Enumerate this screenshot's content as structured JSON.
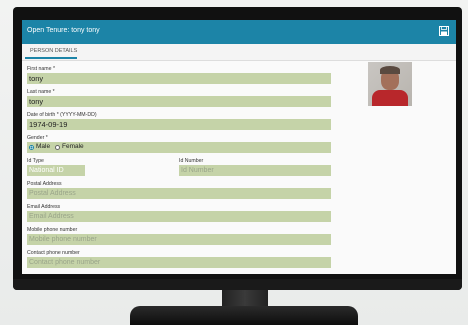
{
  "window": {
    "title": "Open Tenure: tony tony"
  },
  "tabs": [
    {
      "label": "PERSON DETAILS"
    }
  ],
  "form": {
    "first_name": {
      "label": "First name *",
      "value": "tony"
    },
    "last_name": {
      "label": "Last name *",
      "value": "tony"
    },
    "dob": {
      "label": "Date of birth * (YYYY-MM-DD)",
      "value": "1974-09-19"
    },
    "gender": {
      "label": "Gender *",
      "options": [
        "Male",
        "Female"
      ],
      "selected": "Male"
    },
    "id_type": {
      "label": "Id Type",
      "value": "National ID"
    },
    "id_number": {
      "label": "Id Number",
      "placeholder": "Id Number"
    },
    "postal_address": {
      "label": "Postal Address",
      "placeholder": "Postal Address"
    },
    "email": {
      "label": "Email Address",
      "placeholder": "Email Address"
    },
    "mobile": {
      "label": "Mobile phone number",
      "placeholder": "Mobile phone number"
    },
    "contact": {
      "label": "Contact phone number",
      "placeholder": "Contact phone number"
    }
  },
  "icons": {
    "save": "save-icon",
    "photo": "person-photo"
  },
  "colors": {
    "accent": "#1c84a7",
    "field_bg": "#c5d3a8"
  }
}
